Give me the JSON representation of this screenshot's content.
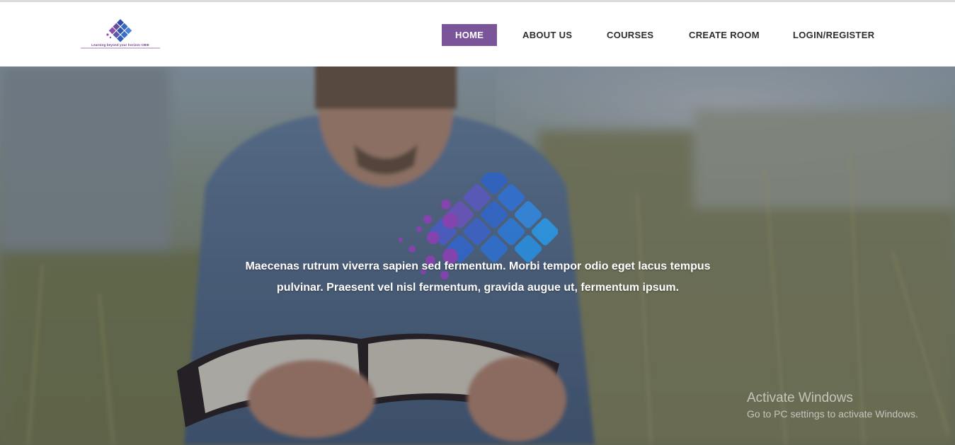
{
  "brand": {
    "logo_tagline": "Learning beyond your horizon CBIE"
  },
  "nav": {
    "items": [
      {
        "label": "HOME",
        "active": true
      },
      {
        "label": "ABOUT US",
        "active": false
      },
      {
        "label": "COURSES",
        "active": false
      },
      {
        "label": "CREATE ROOM",
        "active": false
      },
      {
        "label": "LOGIN/REGISTER",
        "active": false
      }
    ],
    "accent_color": "#7a559a"
  },
  "hero": {
    "line1": "Maecenas rutrum viverra sapien sed fermentum. Morbi tempor odio eget lacus tempus",
    "line2": "pulvinar. Praesent vel nisl fermentum, gravida augue ut, fermentum ipsum.",
    "image": "man-reading-book-in-field"
  },
  "os_watermark": {
    "title": "Activate Windows",
    "subtitle": "Go to PC settings to activate Windows."
  }
}
